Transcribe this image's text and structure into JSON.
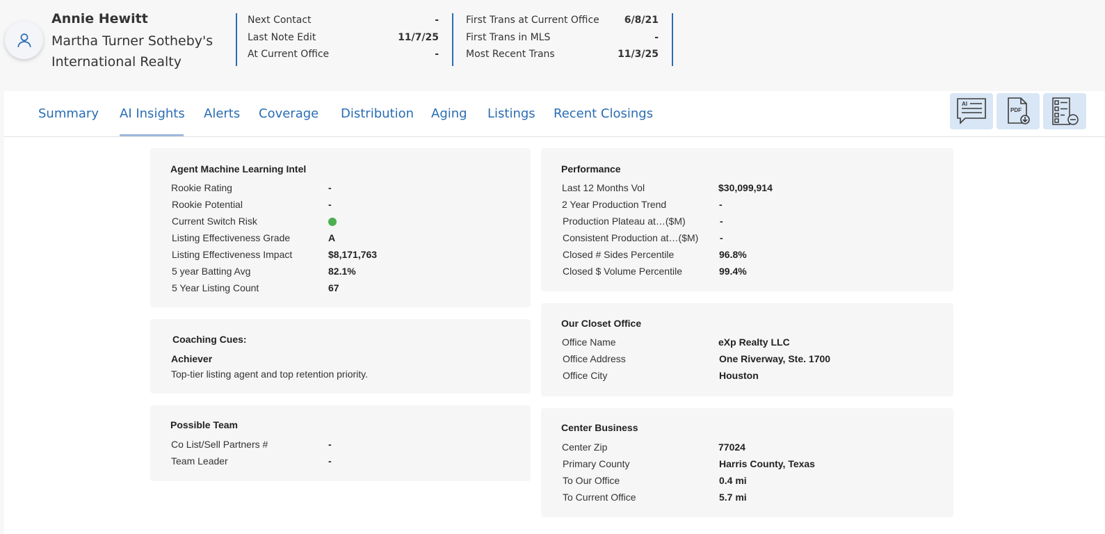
{
  "agent": {
    "name": "Annie Hewitt",
    "office_line1": "Martha Turner Sotheby's",
    "office_line2": "International Realty",
    "avatar_icon": "user-icon"
  },
  "stats_left": [
    {
      "label": "Next Contact",
      "value": "-"
    },
    {
      "label": "Last Note Edit",
      "value": "11/7/25"
    },
    {
      "label": "At Current Office",
      "value": "-"
    }
  ],
  "stats_right": [
    {
      "label": "First Trans at Current Office",
      "value": "6/8/21"
    },
    {
      "label": "First Trans in MLS",
      "value": "-"
    },
    {
      "label": "Most Recent Trans",
      "value": "11/3/25"
    }
  ],
  "tabs": [
    {
      "label": "Summary"
    },
    {
      "label": "AI Insights",
      "active": true
    },
    {
      "label": "Alerts"
    },
    {
      "label": "Coverage"
    },
    {
      "label": "Distribution"
    },
    {
      "label": "Aging"
    },
    {
      "label": "Listings"
    },
    {
      "label": "Recent Closings"
    }
  ],
  "toolbar": {
    "ai_label": "AI",
    "pdf_label": "PDF",
    "icons": [
      "ai-chat-icon",
      "pdf-download-icon",
      "checklist-remove-icon"
    ]
  },
  "colors": {
    "accent": "#2a6db3",
    "status_green": "#4caf50",
    "tool_bg": "#d8e6f5"
  },
  "ml_intel": {
    "title": "Agent Machine Learning Intel",
    "rows": [
      {
        "label": "Rookie Rating",
        "value": "-"
      },
      {
        "label": "Rookie Potential",
        "value": "-"
      },
      {
        "label": "Current Switch Risk",
        "value": ""
      },
      {
        "label": "Listing Effectiveness Grade",
        "value": "A"
      },
      {
        "label": "Listing Effectiveness Impact",
        "value": "$8,171,763"
      },
      {
        "label": "5 year Batting Avg",
        "value": "82.1%"
      },
      {
        "label": "5 Year Listing Count",
        "value": "67"
      }
    ]
  },
  "coaching": {
    "title": "Coaching Cues:",
    "type": "Achiever",
    "text": "Top-tier listing agent and top retention priority."
  },
  "team": {
    "title": "Possible Team",
    "rows": [
      {
        "label": "Co List/Sell Partners #",
        "value": "-"
      },
      {
        "label": "Team Leader",
        "value": "-"
      }
    ]
  },
  "performance": {
    "title": "Performance",
    "rows": [
      {
        "label": "Last 12 Months Vol",
        "value": "$30,099,914"
      },
      {
        "label": "2 Year Production Trend",
        "value": "-"
      },
      {
        "label": "Production Plateau at…($M)",
        "value": "-"
      },
      {
        "label": "Consistent Production at…($M)",
        "value": "-"
      },
      {
        "label": "Closed # Sides Percentile",
        "value": "96.8%"
      },
      {
        "label": "Closed $ Volume Percentile",
        "value": "99.4%"
      }
    ]
  },
  "closest_office": {
    "title": "Our Closet Office",
    "rows": [
      {
        "label": "Office Name",
        "value": "eXp Realty LLC"
      },
      {
        "label": "Office Address",
        "value": "One Riverway, Ste. 1700"
      },
      {
        "label": "Office City",
        "value": "Houston"
      }
    ]
  },
  "center_business": {
    "title": "Center Business",
    "rows": [
      {
        "label": "Center Zip",
        "value": "77024"
      },
      {
        "label": "Primary County",
        "value": "Harris County, Texas"
      },
      {
        "label": "To Our Office",
        "value": "0.4 mi"
      },
      {
        "label": "To Current Office",
        "value": "5.7 mi"
      }
    ]
  }
}
